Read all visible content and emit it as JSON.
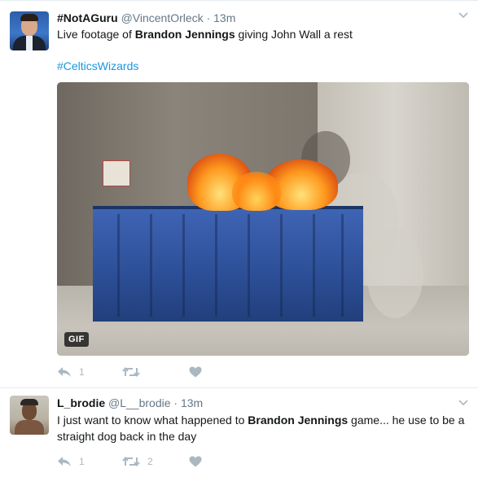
{
  "tweets": [
    {
      "display_name": "#NotAGuru",
      "handle": "@VincentOrleck",
      "separator": "·",
      "time": "13m",
      "text_parts": [
        "Live footage of ",
        "Brandon Jennings",
        " giving John Wall a rest"
      ],
      "hashtag": "#CelticsWizards",
      "media_badge": "GIF",
      "reply_count": "1",
      "retweet_count": "",
      "like_count": ""
    },
    {
      "display_name": "L_brodie",
      "handle": "@L__brodie",
      "separator": "·",
      "time": "13m",
      "text_parts": [
        "I just want to know what happened to ",
        "Brandon Jennings",
        " game... he use to be a straight dog back in the day"
      ],
      "reply_count": "1",
      "retweet_count": "2",
      "like_count": ""
    }
  ],
  "icons": {
    "reply": "reply-icon",
    "retweet": "retweet-icon",
    "like": "heart-icon",
    "menu": "chevron-down-icon"
  },
  "colors": {
    "action_gray": "#aab8c2",
    "link_blue": "#1b95e0",
    "secondary_text": "#657786"
  }
}
